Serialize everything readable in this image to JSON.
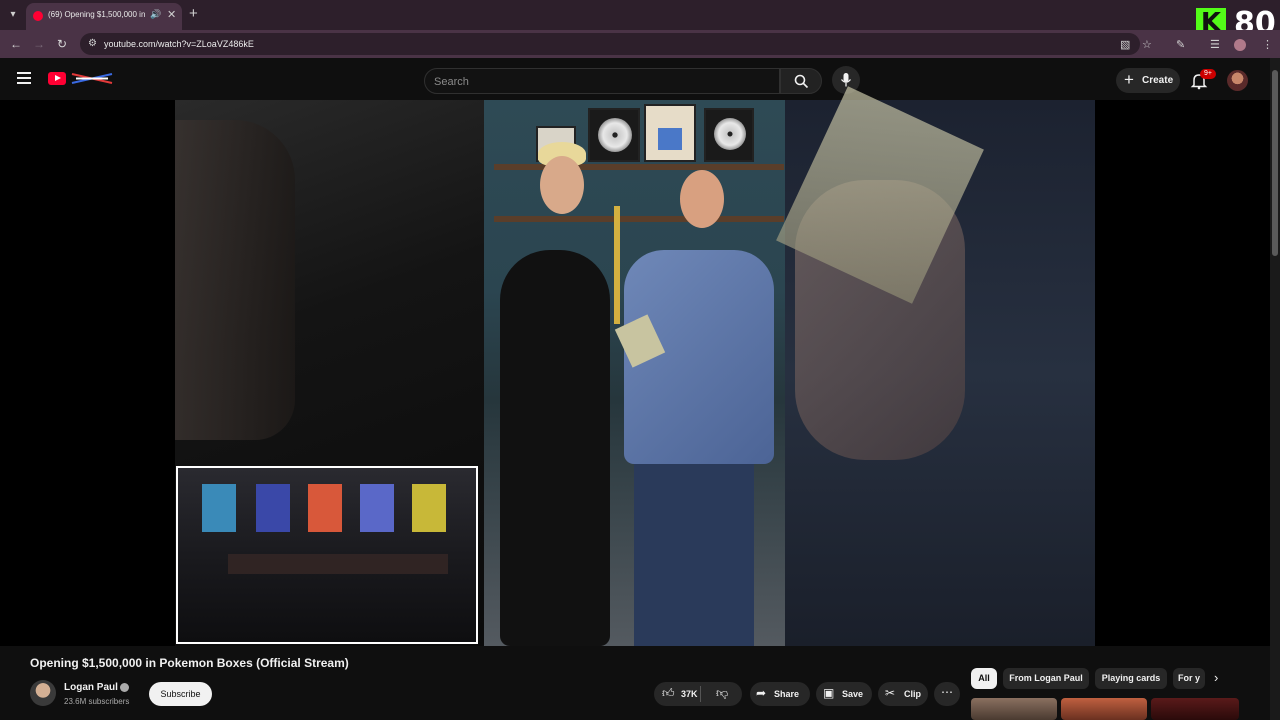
{
  "browser": {
    "tab_title": "(69) Opening $1,500,000 in",
    "url": "youtube.com/watch?v=ZLoaVZ486kE"
  },
  "overlay": {
    "kick_logo_letter": "K",
    "kick_viewer_count": "80"
  },
  "header": {
    "search_placeholder": "Search",
    "create_label": "Create",
    "notification_badge": "9+"
  },
  "video": {
    "title": "Opening $1,500,000 in Pokemon Boxes (Official Stream)",
    "channel_name": "Logan Paul",
    "subscribers": "23.6M subscribers",
    "subscribe_label": "Subscribe",
    "like_count": "37K",
    "share_label": "Share",
    "save_label": "Save",
    "clip_label": "Clip"
  },
  "chips": [
    {
      "label": "All",
      "active": true
    },
    {
      "label": "From Logan Paul",
      "active": false
    },
    {
      "label": "Playing cards",
      "active": false
    },
    {
      "label": "For y",
      "active": false
    }
  ],
  "colors": {
    "brand_red": "#ff0033",
    "kick_green": "#53fc18",
    "background": "#0f0f0f"
  },
  "icons": [
    "menu-icon",
    "search-icon",
    "mic-icon",
    "bell-icon",
    "like-icon",
    "dislike-icon",
    "share-icon",
    "save-icon",
    "clip-icon",
    "more-icon",
    "chevron-right-icon"
  ]
}
